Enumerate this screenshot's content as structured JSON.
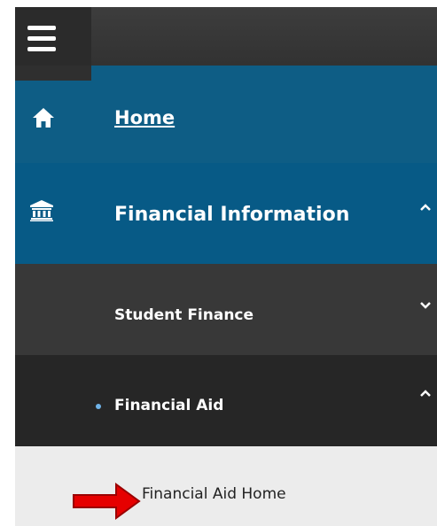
{
  "nav": {
    "menu_icon": "hamburger-menu-icon",
    "items": [
      {
        "label": "Home",
        "icon": "home-icon"
      },
      {
        "label": "Financial Information",
        "icon": "bank-icon",
        "expanded": true
      },
      {
        "label": "Student Finance",
        "expanded": false
      },
      {
        "label": "Financial Aid",
        "expanded": true
      },
      {
        "label": "Financial Aid Home"
      }
    ]
  },
  "colors": {
    "primary_blue": "#075a86",
    "dark_row": "#262626",
    "mid_row": "#383838",
    "light_row": "#ececec",
    "bullet": "#6fb3e8",
    "annotation_arrow": "#e60000"
  }
}
